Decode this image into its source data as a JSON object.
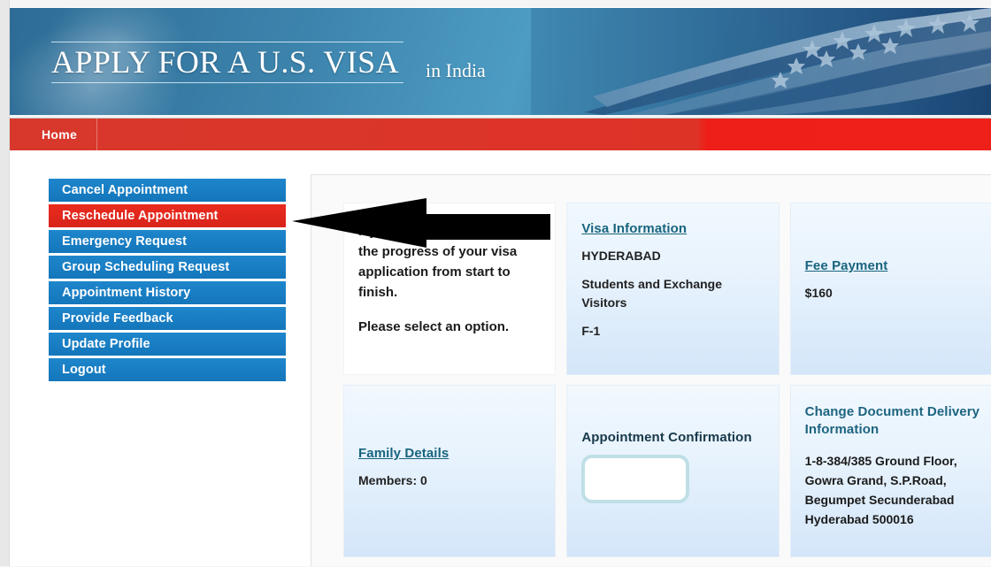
{
  "banner": {
    "title": "APPLY FOR A U.S. VISA",
    "subtitle": "in  India",
    "flag_icon": "us-flag-image"
  },
  "navbar": {
    "items": [
      {
        "label": "Home"
      }
    ],
    "bg_color": "#dd3327"
  },
  "sidebar": {
    "items": [
      {
        "label": "Cancel Appointment",
        "state": "default"
      },
      {
        "label": "Reschedule Appointment",
        "state": "active"
      },
      {
        "label": "Emergency Request",
        "state": "default"
      },
      {
        "label": "Group Scheduling Request",
        "state": "default"
      },
      {
        "label": "Appointment History",
        "state": "default"
      },
      {
        "label": "Provide Feedback",
        "state": "default"
      },
      {
        "label": "Update Profile",
        "state": "default"
      },
      {
        "label": "Logout",
        "state": "default"
      }
    ],
    "default_color": "#1879c4",
    "active_color": "#e8211a"
  },
  "dashboard": {
    "intro": {
      "paragraph1": "My Dashboard lets you track the progress of your visa application from start to finish.",
      "paragraph2": "Please select an option."
    },
    "visa_information": {
      "link_label": "Visa Information",
      "location": "HYDERABAD",
      "category": "Students and Exchange Visitors",
      "visa_class": "F-1"
    },
    "fee_payment": {
      "link_label": "Fee Payment",
      "amount": "$160"
    },
    "family_details": {
      "link_label": "Family Details",
      "members": "Members: 0"
    },
    "appointment_confirmation": {
      "title": "Appointment Confirmation",
      "value": ""
    },
    "document_delivery": {
      "link_label": "Change Document Delivery Information",
      "address_line1": "1-8-384/385 Ground Floor,",
      "address_line2": "Gowra Grand, S.P.Road,",
      "address_line3": "Begumpet Secunderabad",
      "address_line4": "Hyderabad 500016"
    },
    "link_color": "#18647e",
    "card_bg_color": "#e8f3fd"
  },
  "annotation": {
    "arrow": "left-pointing-arrow",
    "arrow_color": "#000000",
    "points_at": "Reschedule Appointment"
  }
}
